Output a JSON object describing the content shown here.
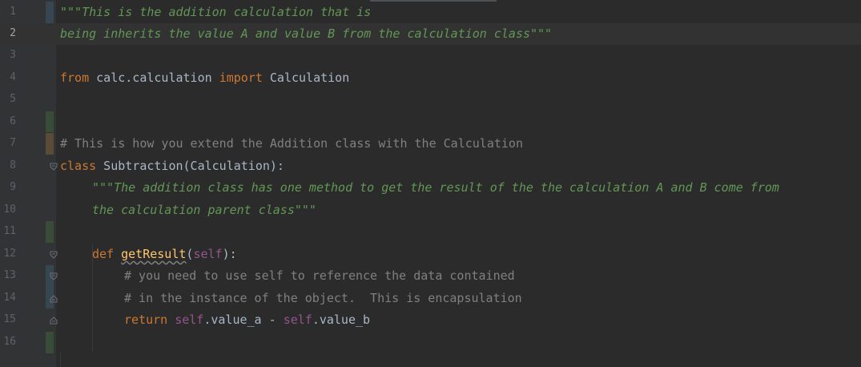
{
  "editor": {
    "language": "python",
    "current_line": 2,
    "colors": {
      "background": "#2b2b2b",
      "gutter": "#313335",
      "keyword": "#cc7832",
      "docstring": "#629755",
      "comment": "#808080",
      "self": "#94558d",
      "function_name": "#ffc66d",
      "text": "#a9b7c6",
      "vcs_modified": "#374752",
      "vcs_added": "#384c38"
    },
    "line_numbers": [
      "1",
      "2",
      "3",
      "4",
      "5",
      "6",
      "7",
      "8",
      "9",
      "10",
      "11",
      "12",
      "13",
      "14",
      "15",
      "16"
    ],
    "code": {
      "l1": "\"\"\"This is the addition calculation that is",
      "l2": "being inherits the value A and value B from the calculation class\"\"\"",
      "l4_from": "from",
      "l4_module": " calc.calculation ",
      "l4_import": "import",
      "l4_name": " Calculation",
      "l7": "# This is how you extend the Addition class with the Calculation",
      "l8_class": "class",
      "l8_rest": " Subtraction(Calculation):",
      "l9": "\"\"\"The addition class has one method to get the result of the the calculation A and B come from",
      "l10": "the calculation parent class\"\"\"",
      "l12_def": "def",
      "l12_name": "getResult",
      "l12_open": "(",
      "l12_self": "self",
      "l12_close": "):",
      "l13": "# you need to use self to reference the data contained",
      "l14": "# in the instance of the object.  This is encapsulation",
      "l15_return": "return",
      "l15_self1": "self",
      "l15_mid": ".value_a - ",
      "l15_self2": "self",
      "l15_end": ".value_b"
    },
    "fold_icons": {
      "class_fold": "fold-collapse-icon",
      "def_fold": "fold-collapse-icon",
      "end_fold": "fold-end-icon"
    }
  }
}
